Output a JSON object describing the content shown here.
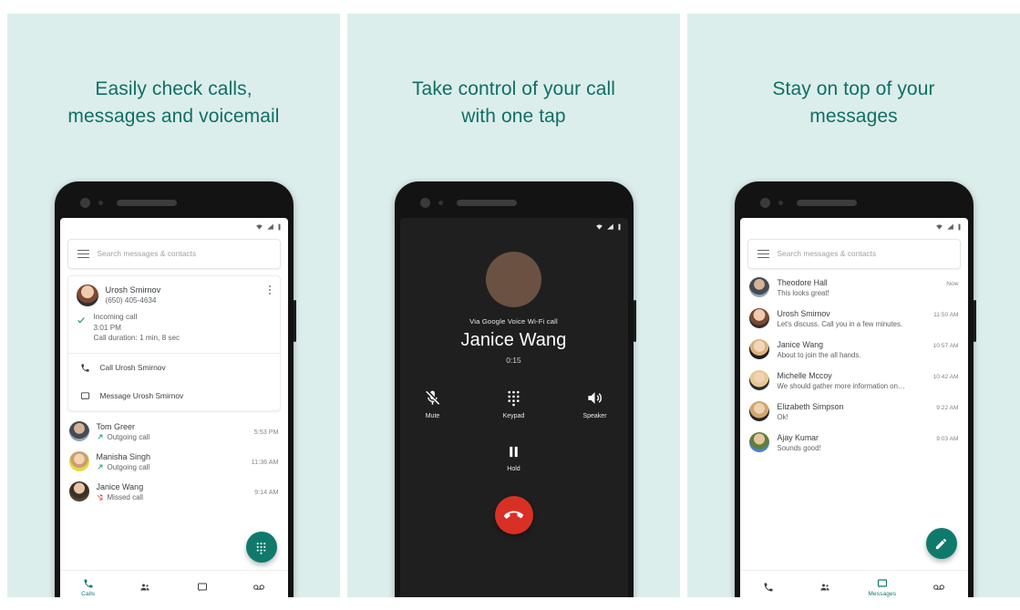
{
  "theme": {
    "panel_bg": "#dceeec",
    "headline_color": "#0f6f64",
    "accent": "#0f7a6c",
    "end_call": "#d93025",
    "dark_screen": "#1f1f1f"
  },
  "panels": [
    {
      "headline": "Easily check calls, messages and voicemail",
      "headline_line1": "Easily check calls,",
      "headline_line2": "messages and voicemail",
      "search": {
        "placeholder": "Search messages & contacts"
      },
      "call_card": {
        "name": "Urosh Smirnov",
        "number": "(650) 405-4634",
        "call_type": "Incoming call",
        "time": "3:01 PM",
        "duration": "Call duration: 1 min, 8 sec",
        "action_call": "Call Urosh Smirnov",
        "action_message": "Message Urosh Smirnov"
      },
      "recent_calls": [
        {
          "name": "Tom Greer",
          "type": "Outgoing call",
          "time": "5:53 PM",
          "direction": "outgoing"
        },
        {
          "name": "Manisha Singh",
          "type": "Outgoing call",
          "time": "11:36 AM",
          "direction": "outgoing"
        },
        {
          "name": "Janice Wang",
          "type": "Missed call",
          "time": "9:14 AM",
          "direction": "missed"
        }
      ],
      "fab": "dialpad-icon",
      "bottom_nav": [
        {
          "label": "Calls",
          "icon": "phone-icon",
          "active": true
        },
        {
          "label": "",
          "icon": "contacts-icon",
          "active": false
        },
        {
          "label": "",
          "icon": "messages-icon",
          "active": false
        },
        {
          "label": "",
          "icon": "voicemail-icon",
          "active": false
        }
      ]
    },
    {
      "headline": "Take control of your call with one tap",
      "headline_line1": "Take control of your call",
      "headline_line2": "with one tap",
      "in_call": {
        "via": "Via Google Voice Wi-Fi call",
        "callee": "Janice Wang",
        "timer": "0:15",
        "controls": [
          {
            "label": "Mute",
            "icon": "mic-off-icon"
          },
          {
            "label": "Keypad",
            "icon": "dialpad-icon"
          },
          {
            "label": "Speaker",
            "icon": "speaker-icon"
          }
        ],
        "hold": {
          "label": "Hold",
          "icon": "pause-icon"
        },
        "end_call_icon": "end-call-icon"
      }
    },
    {
      "headline": "Stay on top of your messages",
      "headline_line1": "Stay on top of your",
      "headline_line2": "messages",
      "search": {
        "placeholder": "Search messages & contacts"
      },
      "messages": [
        {
          "name": "Theodore Hall",
          "snippet": "This looks great!",
          "time": "Now"
        },
        {
          "name": "Urosh Smirnov",
          "snippet": "Let's discuss. Call you in a few minutes.",
          "time": "11:50 AM"
        },
        {
          "name": "Janice Wang",
          "snippet": "About to join the all hands.",
          "time": "10:57 AM"
        },
        {
          "name": "Michelle Mccoy",
          "snippet": "We should gather more information on…",
          "time": "10:42 AM"
        },
        {
          "name": "Elizabeth Simpson",
          "snippet": "Ok!",
          "time": "9:22 AM"
        },
        {
          "name": "Ajay Kumar",
          "snippet": "Sounds good!",
          "time": "9:03 AM"
        }
      ],
      "fab": "compose-icon",
      "bottom_nav": [
        {
          "label": "",
          "icon": "phone-icon",
          "active": false
        },
        {
          "label": "",
          "icon": "contacts-icon",
          "active": false
        },
        {
          "label": "Messages",
          "icon": "messages-icon",
          "active": true
        },
        {
          "label": "",
          "icon": "voicemail-icon",
          "active": false
        }
      ]
    }
  ]
}
